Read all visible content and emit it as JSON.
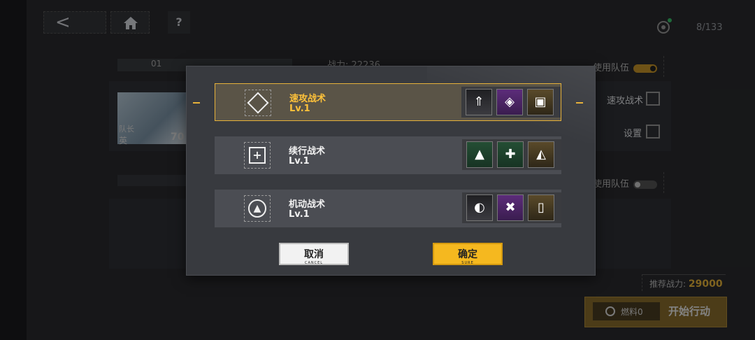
{
  "topbar": {
    "back_glyph": "<",
    "home_icon": "home-icon",
    "help_label": "?",
    "counter": "8/133"
  },
  "background": {
    "team_tab_number": "01",
    "power_label": "战力: 22236",
    "use_team_label": "使用队伍",
    "use_team_label_2": "使用队伍",
    "char_name": "英",
    "char_tag": "队长",
    "char_level": "70",
    "tactic_label": "速攻战术",
    "setting_label": "设置",
    "recommended_power_label": "推荐战力:",
    "recommended_power_value": "29000",
    "fuel_label": "燃料0",
    "start_label": "开始行动",
    "colors": {
      "accent": "#e6b13a",
      "toggle_on": "#c89628"
    }
  },
  "dialog": {
    "rows": [
      {
        "title": "速攻战术",
        "level": "Lv.1",
        "selected": true,
        "skills": [
          "blade-skill-icon",
          "diamond-skill-icon",
          "box-skill-icon"
        ],
        "skill_glyphs": [
          "⇑",
          "◈",
          "▣"
        ]
      },
      {
        "title": "续行战术",
        "level": "Lv.1",
        "selected": false,
        "skills": [
          "mountain-skill-icon",
          "cross-skill-icon",
          "triangle-skill-icon"
        ],
        "skill_glyphs": [
          "▲",
          "✚",
          "◭"
        ]
      },
      {
        "title": "机动战术",
        "level": "Lv.1",
        "selected": false,
        "skills": [
          "wing-skill-icon",
          "x-skill-icon",
          "phone-skill-icon"
        ],
        "skill_glyphs": [
          "◐",
          "✖",
          "▯"
        ]
      }
    ],
    "cancel_label": "取消",
    "cancel_sub": "CANCEL",
    "sure_label": "确定",
    "sure_sub": "SURE"
  }
}
